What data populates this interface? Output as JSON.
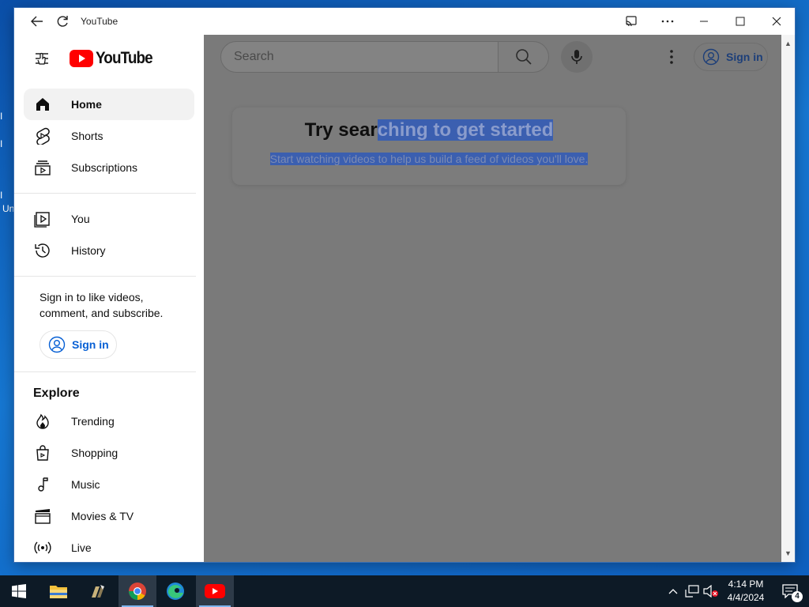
{
  "desktop": {
    "marks": [
      "I",
      "I",
      "I",
      "Un"
    ]
  },
  "window": {
    "title": "YouTube"
  },
  "sidebar": {
    "logo_text": "YouTube",
    "primary": [
      {
        "label": "Home",
        "icon": "home-icon",
        "active": true
      },
      {
        "label": "Shorts",
        "icon": "shorts-icon"
      },
      {
        "label": "Subscriptions",
        "icon": "subscriptions-icon"
      }
    ],
    "secondary": [
      {
        "label": "You",
        "icon": "you-icon"
      },
      {
        "label": "History",
        "icon": "history-icon"
      }
    ],
    "signin_note": "Sign in to like videos, comment, and subscribe.",
    "signin_label": "Sign in",
    "explore_title": "Explore",
    "explore": [
      {
        "label": "Trending",
        "icon": "trending-icon"
      },
      {
        "label": "Shopping",
        "icon": "shopping-icon"
      },
      {
        "label": "Music",
        "icon": "music-icon"
      },
      {
        "label": "Movies & TV",
        "icon": "movies-icon"
      },
      {
        "label": "Live",
        "icon": "live-icon"
      }
    ]
  },
  "header": {
    "search_placeholder": "Search",
    "signin_label": "Sign in"
  },
  "main": {
    "title_plain": "Try sear",
    "title_selected": "ching to get started",
    "subtitle": "Start watching videos to help us build a feed of videos you'll love."
  },
  "taskbar": {
    "apps": [
      "start-icon",
      "file-explorer-icon",
      "app-icon",
      "chrome-icon",
      "edge-icon",
      "youtube-icon"
    ],
    "time": "4:14 PM",
    "date": "4/4/2024",
    "notification_count": "4"
  },
  "colors": {
    "brand_red": "#ff0000",
    "link_blue": "#065fd4",
    "selection": "#3b5fb0"
  }
}
